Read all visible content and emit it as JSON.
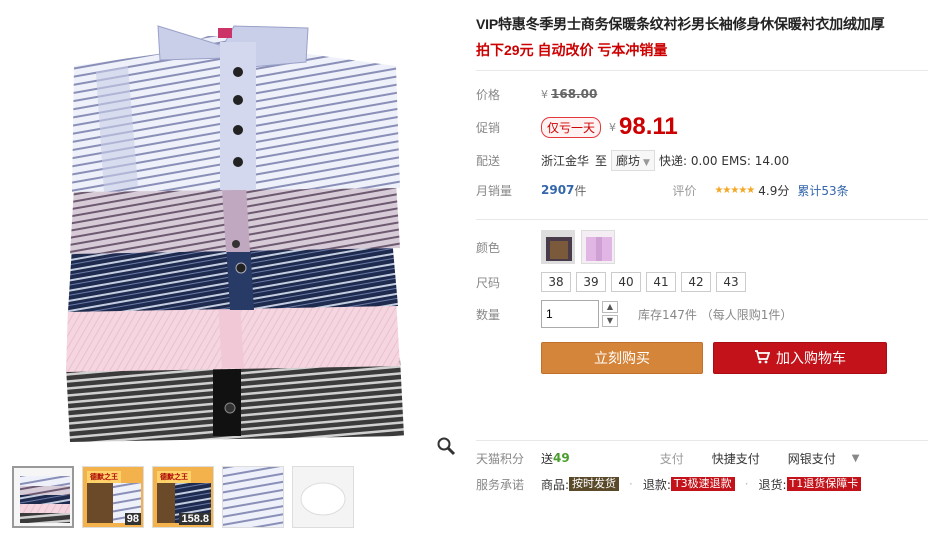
{
  "product": {
    "title": "VIP特惠冬季男士商务保暖条纹衬衫男长袖修身休保暖衬衣加绒加厚",
    "subtitle": "拍下29元 自动改价 亏本冲销量"
  },
  "price": {
    "label": "价格",
    "currency": "¥",
    "original": "168.00"
  },
  "promo": {
    "label": "促销",
    "tag": "仅亏一天",
    "currency": "¥",
    "price": "98.11"
  },
  "delivery": {
    "label": "配送",
    "origin": "浙江金华",
    "to": "至",
    "destination": "廊坊",
    "fees": "快递: 0.00 EMS: 14.00"
  },
  "sales": {
    "label": "月销量",
    "count": "2907",
    "unit": "件",
    "rating_label": "评价",
    "stars": "★★★★★",
    "score": "4.9分",
    "reviews": "累计53条"
  },
  "sku": {
    "color_label": "颜色",
    "size_label": "尺码",
    "sizes": [
      "38",
      "39",
      "40",
      "41",
      "42",
      "43"
    ],
    "qty_label": "数量",
    "qty_value": "1",
    "stock": "库存147件 （每人限购1件）"
  },
  "actions": {
    "buy": "立刻购买",
    "cart": "加入购物车"
  },
  "footer": {
    "points_label": "天猫积分",
    "points_prefix": "送",
    "points": "49",
    "pay_label": "支付",
    "pay_quick": "快捷支付",
    "pay_bank": "网银支付",
    "promise_label": "服务承诺",
    "goods_key": "商品:",
    "goods_tag": "按时发货",
    "refund_key": "退款:",
    "refund_tag": "T3极速退款",
    "return_key": "退货:",
    "return_tag": "T1退货保障卡"
  },
  "gallery": {
    "thumb_prices": [
      "98",
      "158.8"
    ],
    "thumb_badge": "德默之王"
  },
  "colors": {
    "promo_red": "#c00",
    "buy_orange": "#d4853a",
    "cart_red": "#c31219"
  }
}
